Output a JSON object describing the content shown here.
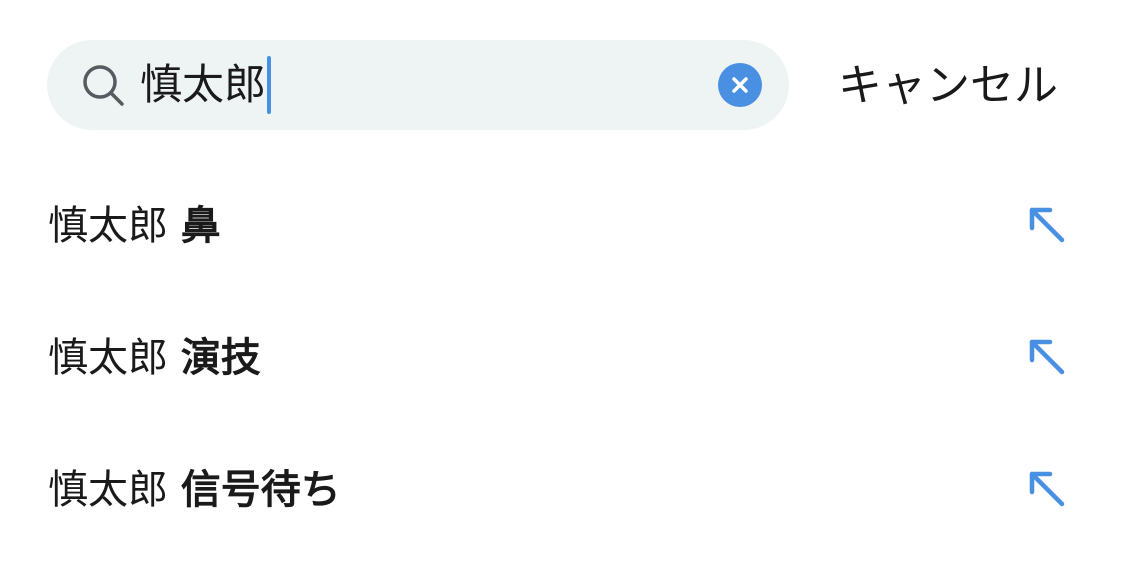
{
  "search": {
    "value": "慎太郎"
  },
  "cancel_label": "キャンセル",
  "suggestions": [
    {
      "query": "慎太郎",
      "completion": "鼻"
    },
    {
      "query": "慎太郎",
      "completion": "演技"
    },
    {
      "query": "慎太郎",
      "completion": "信号待ち"
    }
  ],
  "colors": {
    "accent": "#4a90e2",
    "search_bg": "#eef3f4",
    "text": "#1a1a1a"
  },
  "icons": {
    "search": "search-icon",
    "clear": "clear-icon",
    "fill": "arrow-up-left-icon"
  }
}
